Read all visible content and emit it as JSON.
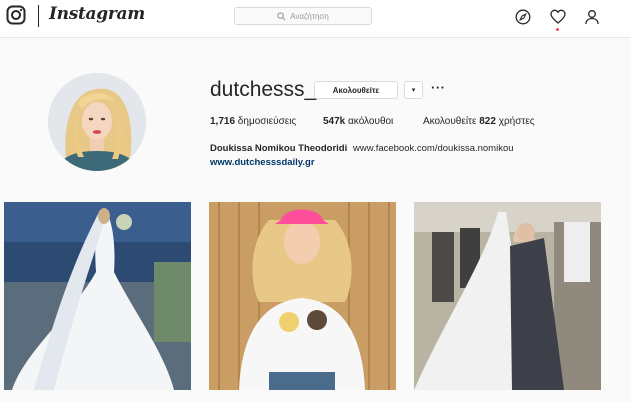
{
  "nav": {
    "brand": "Instagram",
    "search_placeholder": "Αναζήτηση",
    "icons": [
      "camera-logo-icon",
      "compass-icon",
      "heart-icon",
      "user-icon"
    ],
    "notification_color": "#ed4956"
  },
  "profile": {
    "username": "dutchesss_",
    "follow_label": "Ακολουθείτε",
    "dropdown_glyph": "▾",
    "more_glyph": "···",
    "stats": {
      "posts_count": "1,716",
      "posts_label": " δημοσιεύσεις",
      "followers_count": "547k",
      "followers_label": " ακόλουθοι",
      "following_prefix": "Ακολουθείτε ",
      "following_count": "822",
      "following_label": " χρήστες"
    },
    "full_name": "Doukissa Nomikou Theodoridi",
    "bio": "www.facebook.com/doukissa.nomikou",
    "website": "www.dutchesssdaily.gr"
  },
  "posts": [
    "bride-by-sea-photo",
    "white-tshirt-pink-cap-photo",
    "wedding-kiss-photo"
  ],
  "colors": {
    "text": "#262626",
    "link": "#003569",
    "border": "#dbdbdb",
    "background": "#fafafa"
  }
}
